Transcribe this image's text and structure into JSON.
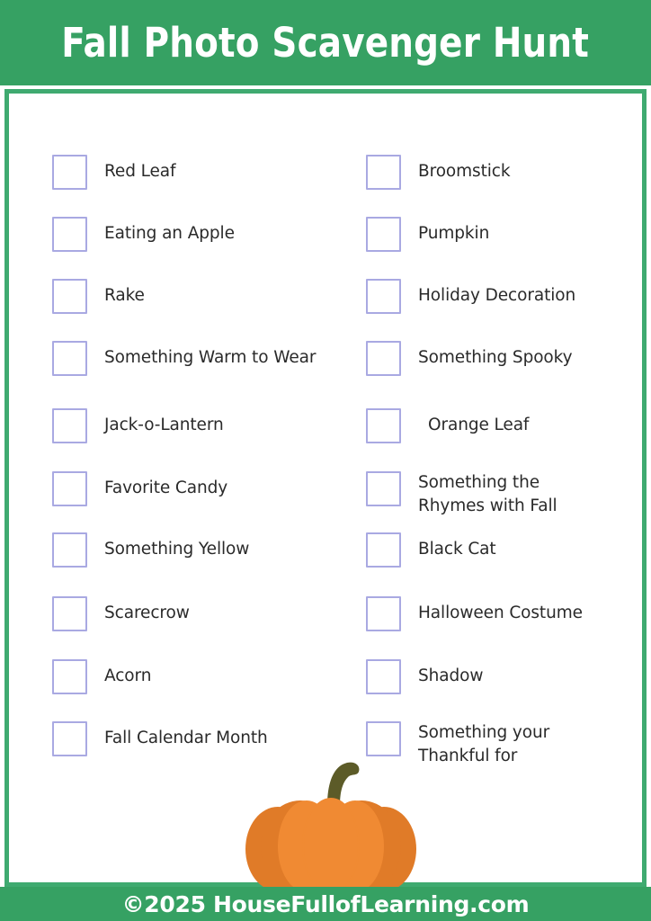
{
  "header": {
    "title": "Fall Photo Scavenger Hunt",
    "background_color": "#36a163",
    "text_color": "#ffffff"
  },
  "theme": {
    "green": "#36a163",
    "frame_green": "#3faa70",
    "checkbox_border": "#a9a9e2",
    "text": "#2a2a2a",
    "pumpkin_orange_dark": "#e07b28",
    "pumpkin_orange_light": "#f08a33",
    "pumpkin_stem": "#5c5b28"
  },
  "checklist": {
    "left_column": [
      {
        "label": "Red Leaf",
        "checked": false
      },
      {
        "label": "Eating an Apple",
        "checked": false
      },
      {
        "label": "Rake",
        "checked": false
      },
      {
        "label": "Something Warm to Wear",
        "checked": false
      },
      {
        "label": "Jack-o-Lantern",
        "checked": false
      },
      {
        "label": "Favorite Candy",
        "checked": false
      },
      {
        "label": "Something Yellow",
        "checked": false
      },
      {
        "label": "Scarecrow",
        "checked": false
      },
      {
        "label": "Acorn",
        "checked": false
      },
      {
        "label": "Fall Calendar Month",
        "checked": false
      }
    ],
    "right_column": [
      {
        "label": "Broomstick",
        "checked": false
      },
      {
        "label": "Pumpkin",
        "checked": false
      },
      {
        "label": "Holiday Decoration",
        "checked": false
      },
      {
        "label": "Something Spooky",
        "checked": false
      },
      {
        "label": "Orange Leaf",
        "checked": false
      },
      {
        "label": "Something the\nRhymes with Fall",
        "checked": false
      },
      {
        "label": "Black Cat",
        "checked": false
      },
      {
        "label": "Halloween Costume",
        "checked": false
      },
      {
        "label": "Shadow",
        "checked": false
      },
      {
        "label": "Something your\nThankful for",
        "checked": false
      }
    ]
  },
  "decoration": {
    "pumpkin_icon": "pumpkin-illustration"
  },
  "footer": {
    "copyright": "©2025 HouseFullofLearning.com"
  }
}
